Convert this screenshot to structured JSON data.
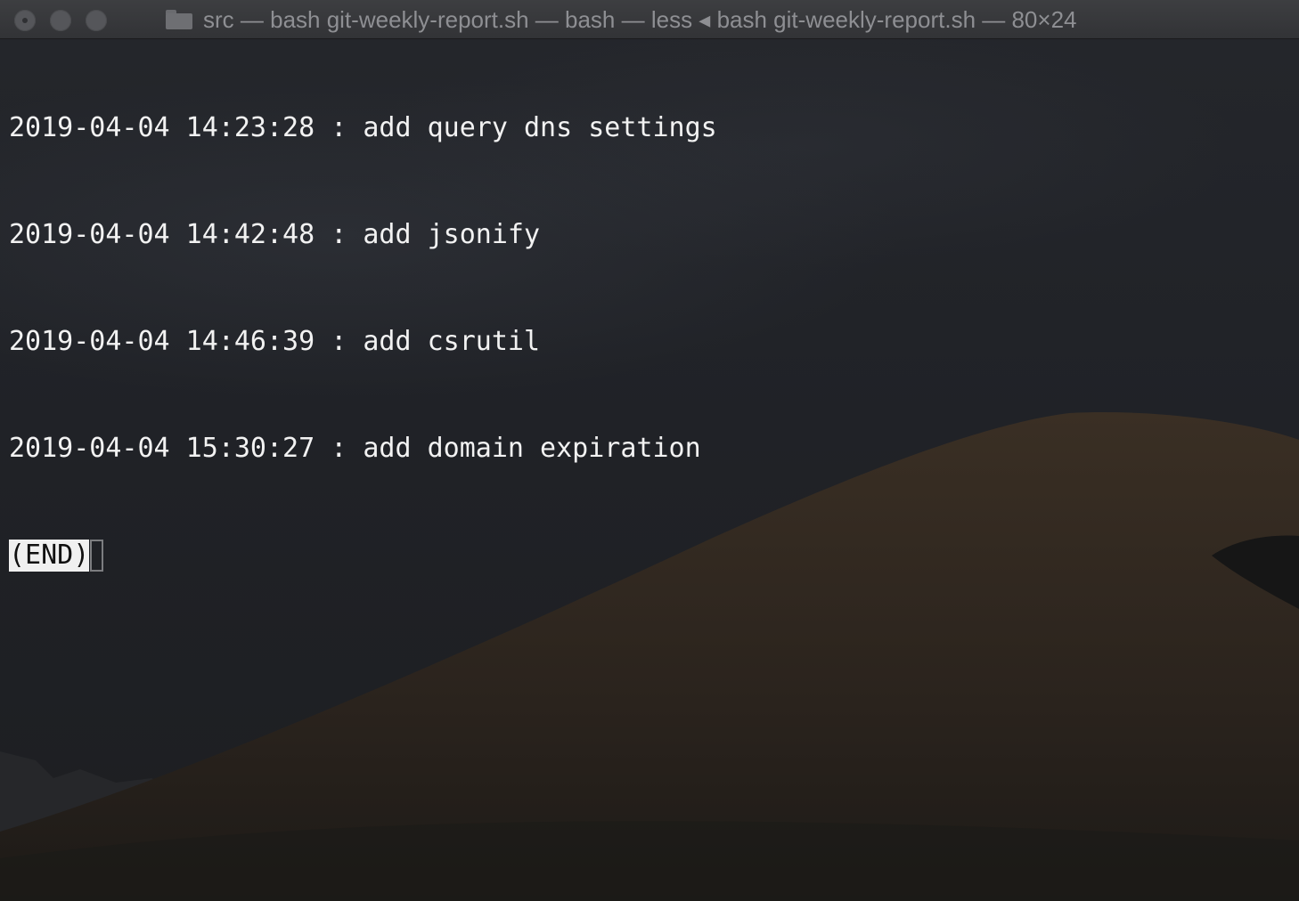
{
  "window": {
    "title": "src — bash git-weekly-report.sh — bash — less ◂ bash git-weekly-report.sh — 80×24",
    "icon": "folder-icon",
    "controls": [
      "close",
      "minimize",
      "zoom"
    ]
  },
  "terminal": {
    "lines": [
      "2019-04-04 14:23:28 : add query dns settings",
      "2019-04-04 14:42:48 : add jsonify",
      "2019-04-04 14:46:39 : add csrutil",
      "2019-04-04 15:30:27 : add domain expiration"
    ],
    "end_marker": "(END)"
  },
  "colors": {
    "text": "#f2f2f2",
    "end_marker_bg": "#f0f0f0",
    "title_text": "#8e8f93",
    "background": "#202226"
  }
}
